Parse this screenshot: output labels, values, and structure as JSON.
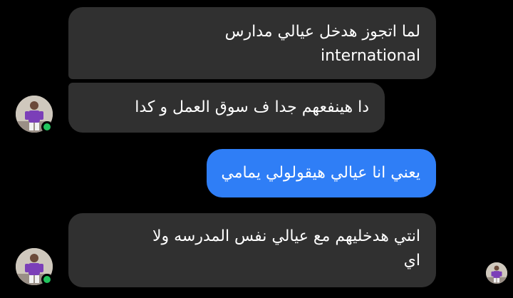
{
  "messages": [
    {
      "direction": "incoming",
      "lines": [
        "لما اتجوز هدخل عيالي مدارس",
        "international"
      ]
    },
    {
      "direction": "incoming",
      "lines": [
        "دا هينفعهم جدا ف سوق العمل و كدا"
      ]
    },
    {
      "direction": "outgoing",
      "lines": [
        "يعني انا عيالي هيقولولي يمامي"
      ]
    },
    {
      "direction": "incoming",
      "lines": [
        "انتي هدخليهم مع عيالي نفس المدرسه ولا",
        "اي"
      ]
    }
  ],
  "colors": {
    "background": "#000000",
    "incoming_bubble": "#303030",
    "outgoing_bubble": "#2f7ef6",
    "online_indicator": "#22c55e",
    "text": "#ffffff"
  },
  "icons": {
    "contact_avatar": "contact-avatar-icon",
    "read_receipt": "read-receipt-avatar-icon",
    "online": "online-status-dot"
  }
}
